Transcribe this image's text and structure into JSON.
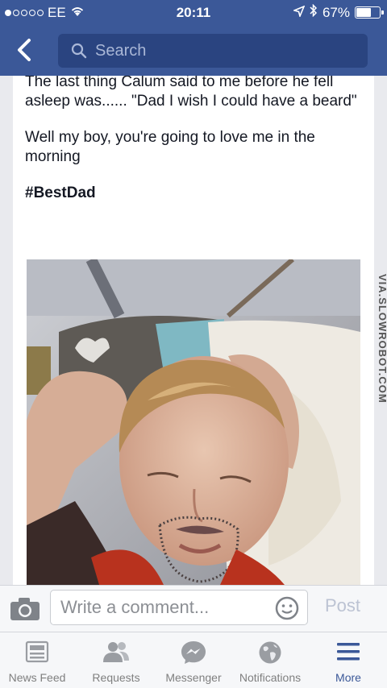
{
  "status_bar": {
    "carrier": "EE",
    "time": "20:11",
    "battery": "67%",
    "battery_level": 0.67,
    "signal_bars": 1
  },
  "nav": {
    "back_icon": "chevron-left-icon",
    "search_placeholder": "Search"
  },
  "post": {
    "paragraphs": [
      "The last thing Calum said to me before he fell asleep was...... \"Dad I wish I could have a beard\"",
      "Well my boy, you're going to love me in the morning",
      "#BestDad"
    ]
  },
  "watermark": "VIA.SLOWROBOT.COM",
  "comment_bar": {
    "placeholder": "Write a comment...",
    "post_label": "Post"
  },
  "tabs": [
    {
      "label": "News Feed",
      "icon": "news-feed-icon",
      "active": false
    },
    {
      "label": "Requests",
      "icon": "friends-icon",
      "active": false
    },
    {
      "label": "Messenger",
      "icon": "messenger-icon",
      "active": false
    },
    {
      "label": "Notifications",
      "icon": "globe-icon",
      "active": false
    },
    {
      "label": "More",
      "icon": "menu-icon",
      "active": true
    }
  ],
  "colors": {
    "brand": "#3b5898",
    "background": "#e9eaee"
  }
}
